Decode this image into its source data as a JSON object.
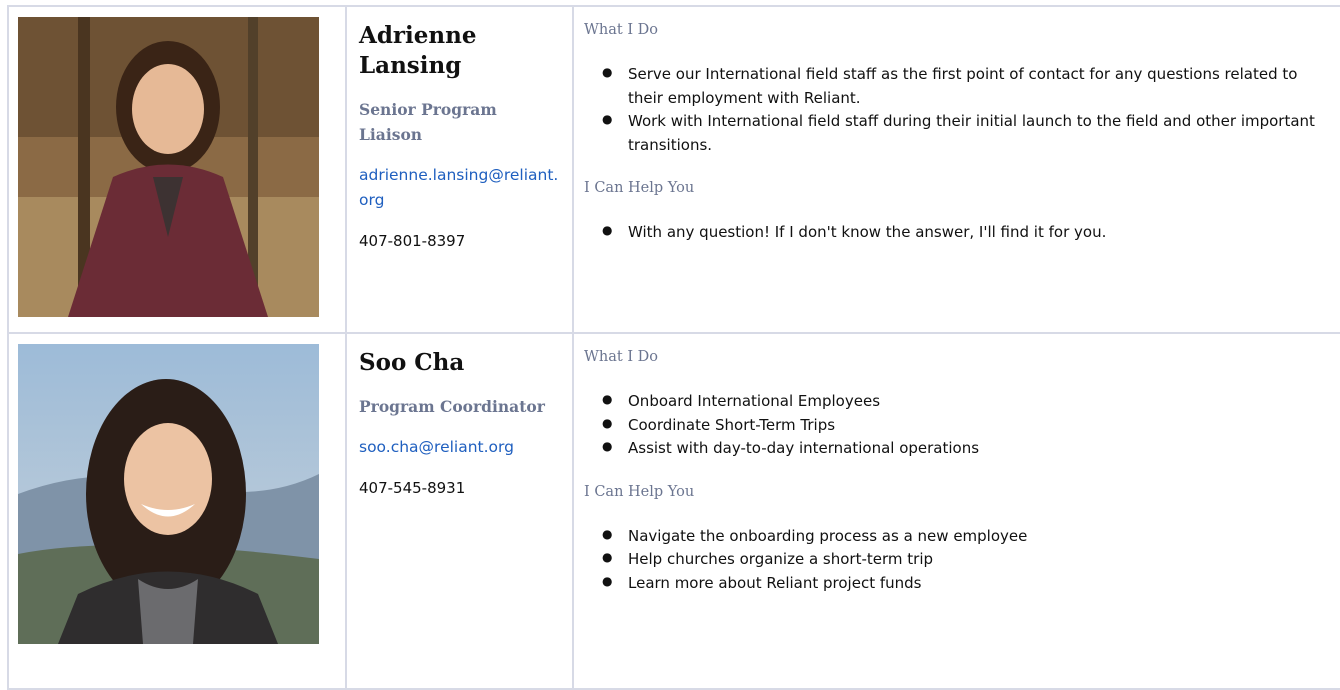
{
  "staff": [
    {
      "name": "Adrienne Lansing",
      "role": "Senior Program Liaison",
      "email": "adrienne.lansing@reliant.org",
      "phone": "407-801-8397",
      "what_i_do_title": "What I Do",
      "what_i_do": [
        "Serve our International field staff as the first point of contact for any questions related to their employment with Reliant.",
        "Work with International field staff during their initial launch to the field and other important transitions."
      ],
      "help_title": "I Can Help You",
      "help": [
        "With any question! If I don't know the answer, I'll find it for you."
      ]
    },
    {
      "name": "Soo Cha",
      "role": "Program Coordinator",
      "email": "soo.cha@reliant.org",
      "phone": "407-545-8931",
      "what_i_do_title": "What I Do",
      "what_i_do": [
        "Onboard International Employees",
        "Coordinate Short-Term Trips",
        "Assist with day-to-day international operations"
      ],
      "help_title": "I Can Help You",
      "help": [
        "Navigate the onboarding process as a new employee",
        "Help churches organize a short-term trip",
        "Learn more about Reliant project funds"
      ]
    }
  ]
}
